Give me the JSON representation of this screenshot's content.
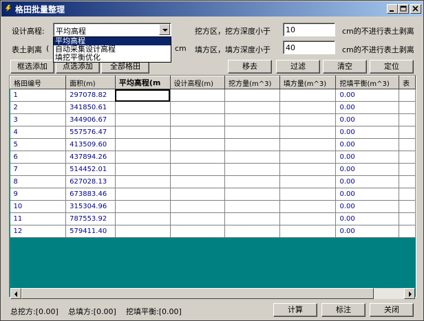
{
  "window": {
    "title": "格田批量整理"
  },
  "form": {
    "design_elev_label": "设计高程:",
    "design_elev_value": "平均高程",
    "dropdown_options": [
      "平均高程",
      "自动采集设计高程",
      "填挖平衡优化"
    ],
    "topsoil_label": "表土剥离",
    "topsoil_paren": "(",
    "topsoil_unit": "cm",
    "cut_label": "挖方区，挖方深度小于",
    "cut_value": "10",
    "cut_suffix": "cm的不进行表土剥离",
    "fill_label": "填方区，填方深度小于",
    "fill_value": "40",
    "fill_suffix": "cm的不进行表土剥离"
  },
  "toolbar": {
    "box_select": "框选添加",
    "point_select": "点选添加",
    "all_fields": "全部格田",
    "remove": "移去",
    "filter": "过滤",
    "clear": "清空",
    "locate": "定位"
  },
  "table": {
    "headers": [
      "格田编号",
      "面积(m)",
      "平均高程(m",
      "设计高程(m)",
      "挖方量(m^3)",
      "填方量(m^3)",
      "挖填平衡(m^3)",
      "表"
    ],
    "rows": [
      [
        "1",
        "297078.82",
        "",
        "",
        "",
        "",
        "0.00"
      ],
      [
        "2",
        "341850.61",
        "",
        "",
        "",
        "",
        "0.00"
      ],
      [
        "3",
        "344906.67",
        "",
        "",
        "",
        "",
        "0.00"
      ],
      [
        "4",
        "557576.47",
        "",
        "",
        "",
        "",
        "0.00"
      ],
      [
        "5",
        "413509.60",
        "",
        "",
        "",
        "",
        "0.00"
      ],
      [
        "6",
        "437894.26",
        "",
        "",
        "",
        "",
        "0.00"
      ],
      [
        "7",
        "514452.01",
        "",
        "",
        "",
        "",
        "0.00"
      ],
      [
        "8",
        "627028.13",
        "",
        "",
        "",
        "",
        "0.00"
      ],
      [
        "9",
        "673883.46",
        "",
        "",
        "",
        "",
        "0.00"
      ],
      [
        "10",
        "315304.96",
        "",
        "",
        "",
        "",
        "0.00"
      ],
      [
        "11",
        "787553.92",
        "",
        "",
        "",
        "",
        "0.00"
      ],
      [
        "12",
        "579411.40",
        "",
        "",
        "",
        "",
        "0.00"
      ]
    ]
  },
  "status": {
    "total_cut": "总挖方:[0.00]",
    "total_fill": "总填方:[0.00]",
    "balance": "挖填平衡:[0.00]"
  },
  "footer": {
    "calc": "计算",
    "annotate": "标注",
    "close": "关闭"
  },
  "colors": {
    "title_start": "#0a246a",
    "title_end": "#a6caf0",
    "grid_bg": "#008080",
    "cell_text": "#00008b"
  }
}
